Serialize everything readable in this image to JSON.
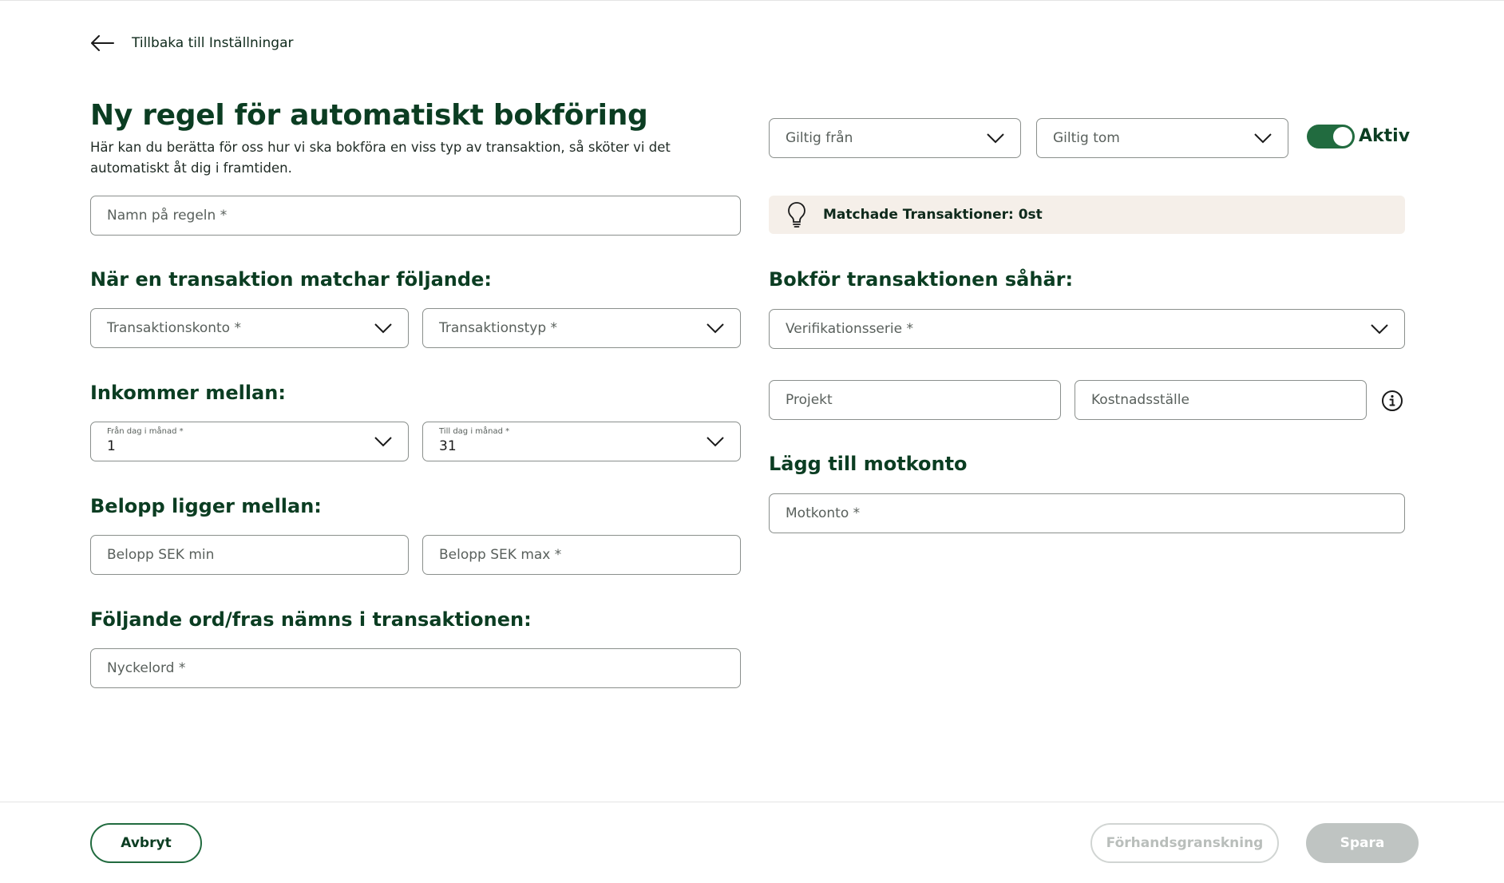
{
  "nav": {
    "back_label": "Tillbaka till Inställningar"
  },
  "header": {
    "title": "Ny regel för automatiskt bokföring",
    "subtitle": "Här kan du berätta för oss hur vi ska bokföra en viss typ av transaktion, så sköter vi det automatiskt åt dig i framtiden."
  },
  "validity": {
    "from_placeholder": "Giltig från",
    "to_placeholder": "Giltig tom",
    "active_label": "Aktiv",
    "active": true
  },
  "rule_name": {
    "placeholder": "Namn på regeln *"
  },
  "match_banner": {
    "text": "Matchade Transaktioner: 0st"
  },
  "conditions": {
    "heading": "När en transaktion matchar följande:",
    "account_placeholder": "Transaktionskonto *",
    "type_placeholder": "Transaktionstyp *"
  },
  "incoming": {
    "heading": "Inkommer mellan:",
    "from_label": "Från dag i månad *",
    "from_value": "1",
    "to_label": "Till dag i månad *",
    "to_value": "31"
  },
  "amount": {
    "heading": "Belopp ligger mellan:",
    "min_placeholder": "Belopp SEK min",
    "max_placeholder": "Belopp SEK max *"
  },
  "keyword": {
    "heading": "Följande ord/fras nämns i transaktionen:",
    "placeholder": "Nyckelord *"
  },
  "booking": {
    "heading": "Bokför transaktionen såhär:",
    "series_placeholder": "Verifikationsserie *",
    "project_placeholder": "Projekt",
    "cost_center_placeholder": "Kostnadsställe"
  },
  "counter_account": {
    "heading": "Lägg till motkonto",
    "placeholder": "Motkonto *"
  },
  "footer": {
    "cancel_label": "Avbryt",
    "preview_label": "Förhandsgranskning",
    "save_label": "Spara"
  },
  "colors": {
    "brand_green": "#216b3f",
    "heading_green": "#0b3d22",
    "banner_bg": "#f5efe9",
    "disabled_button": "#bfc4c2"
  },
  "icons": {
    "back": "arrow-left-icon",
    "chevron": "chevron-down-icon",
    "lightbulb": "lightbulb-icon",
    "info": "info-icon"
  }
}
